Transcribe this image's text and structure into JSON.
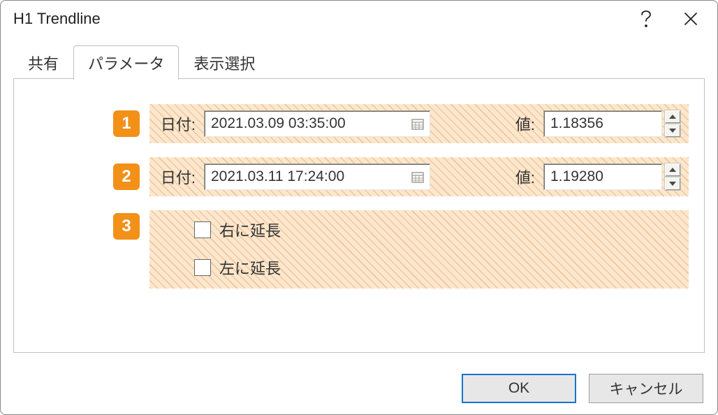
{
  "window": {
    "title": "H1 Trendline"
  },
  "tabs": {
    "items": [
      "共有",
      "パラメータ",
      "表示選択"
    ],
    "active_index": 1
  },
  "params": {
    "rows": [
      {
        "index": "1",
        "date_label": "日付:",
        "date_value": "2021.03.09 03:35:00",
        "value_label": "値:",
        "value": "1.18356"
      },
      {
        "index": "2",
        "date_label": "日付:",
        "date_value": "2021.03.11 17:24:00",
        "value_label": "値:",
        "value": "1.19280"
      }
    ],
    "ext": {
      "index": "3",
      "right": {
        "label": "右に延長",
        "checked": false
      },
      "left": {
        "label": "左に延長",
        "checked": false
      }
    }
  },
  "buttons": {
    "ok": "OK",
    "cancel": "キャンセル"
  }
}
